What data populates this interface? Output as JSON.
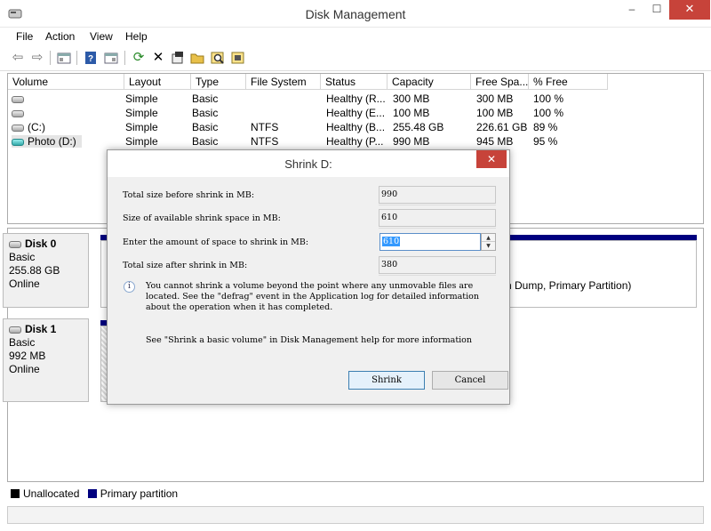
{
  "window": {
    "title": "Disk Management",
    "controls": {
      "minimize": "–",
      "maximize": "☐",
      "close": "✕"
    }
  },
  "menu": [
    "File",
    "Action",
    "View",
    "Help"
  ],
  "toolbar_icons": [
    "back-arrow-icon",
    "forward-arrow-icon",
    "console-tree-icon",
    "help-icon",
    "properties-pane-icon",
    "refresh-icon",
    "delete-icon",
    "properties-icon",
    "open-folder-icon",
    "search-icon",
    "rescan-disks-icon"
  ],
  "volume_list": {
    "columns": [
      "Volume",
      "Layout",
      "Type",
      "File System",
      "Status",
      "Capacity",
      "Free Spa...",
      "% Free"
    ],
    "rows": [
      {
        "volume": "",
        "layout": "Simple",
        "type": "Basic",
        "fs": "",
        "status": "Healthy (R...",
        "capacity": "300 MB",
        "free": "300 MB",
        "pct": "100 %"
      },
      {
        "volume": "",
        "layout": "Simple",
        "type": "Basic",
        "fs": "",
        "status": "Healthy (E...",
        "capacity": "100 MB",
        "free": "100 MB",
        "pct": "100 %"
      },
      {
        "volume": "(C:)",
        "layout": "Simple",
        "type": "Basic",
        "fs": "NTFS",
        "status": "Healthy (B...",
        "capacity": "255.48 GB",
        "free": "226.61 GB",
        "pct": "89 %"
      },
      {
        "volume": "Photo (D:)",
        "layout": "Simple",
        "type": "Basic",
        "fs": "NTFS",
        "status": "Healthy (P...",
        "capacity": "990 MB",
        "free": "945 MB",
        "pct": "95 %"
      }
    ]
  },
  "disks": [
    {
      "name": "Disk 0",
      "type": "Basic",
      "size": "255.88 GB",
      "state": "Online"
    },
    {
      "name": "Disk 1",
      "type": "Basic",
      "size": "992 MB",
      "state": "Online"
    }
  ],
  "partition_text": "h Dump, Primary Partition)",
  "legend": [
    {
      "label": "Unallocated",
      "color": "#000000"
    },
    {
      "label": "Primary partition",
      "color": "#00007f"
    }
  ],
  "dialog": {
    "title": "Shrink D:",
    "close": "✕",
    "fields": [
      {
        "label": "Total size before shrink in MB:",
        "value": "990"
      },
      {
        "label": "Size of available shrink space in MB:",
        "value": "610"
      },
      {
        "label": "Enter the amount of space to shrink in MB:",
        "value": "610"
      },
      {
        "label": "Total size after shrink in MB:",
        "value": "380"
      }
    ],
    "info": "You cannot shrink a volume beyond the point where any unmovable files are located. See the \"defrag\" event in the Application log for detailed information about the operation when it has completed.",
    "help": "See \"Shrink a basic volume\" in Disk Management help for more information",
    "shrink_button": "Shrink",
    "cancel_button": "Cancel"
  }
}
